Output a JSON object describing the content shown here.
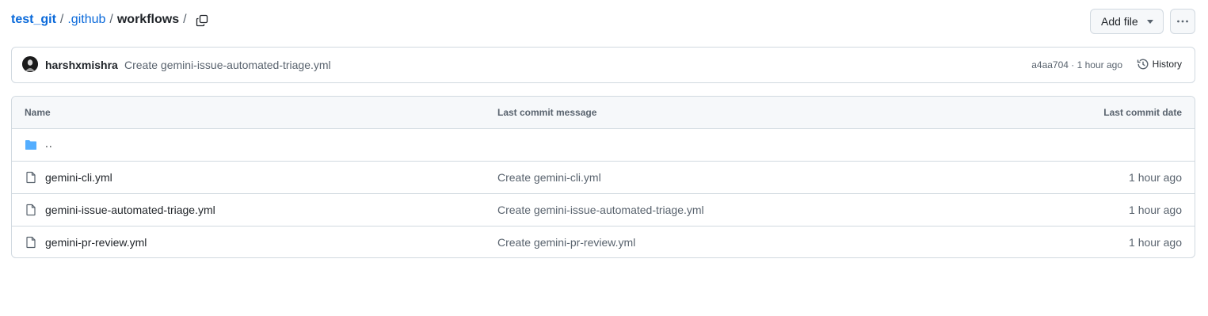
{
  "breadcrumb": {
    "repo": "test_git",
    "dir": ".github",
    "current": "workflows",
    "sep1": "/",
    "sep2": "/",
    "sep3": "/"
  },
  "toolbar": {
    "add_file_label": "Add file"
  },
  "commit": {
    "author": "harshxmishra",
    "message": "Create gemini-issue-automated-triage.yml",
    "hash": "a4aa704",
    "separator": " · ",
    "time": "1 hour ago",
    "history_label": "History"
  },
  "table": {
    "headers": {
      "name": "Name",
      "message": "Last commit message",
      "date": "Last commit date"
    },
    "parent": "..",
    "rows": [
      {
        "name": "gemini-cli.yml",
        "message": "Create gemini-cli.yml",
        "date": "1 hour ago"
      },
      {
        "name": "gemini-issue-automated-triage.yml",
        "message": "Create gemini-issue-automated-triage.yml",
        "date": "1 hour ago"
      },
      {
        "name": "gemini-pr-review.yml",
        "message": "Create gemini-pr-review.yml",
        "date": "1 hour ago"
      }
    ]
  },
  "colors": {
    "link": "#0969da",
    "folder": "#54aeff",
    "border": "#d1d9e0",
    "muted": "#59636e"
  },
  "icons": {
    "copy": "copy-icon",
    "caret": "triangle-down-icon",
    "more": "kebab-horizontal-icon",
    "history": "history-icon",
    "folder": "folder-icon",
    "file": "file-icon"
  }
}
